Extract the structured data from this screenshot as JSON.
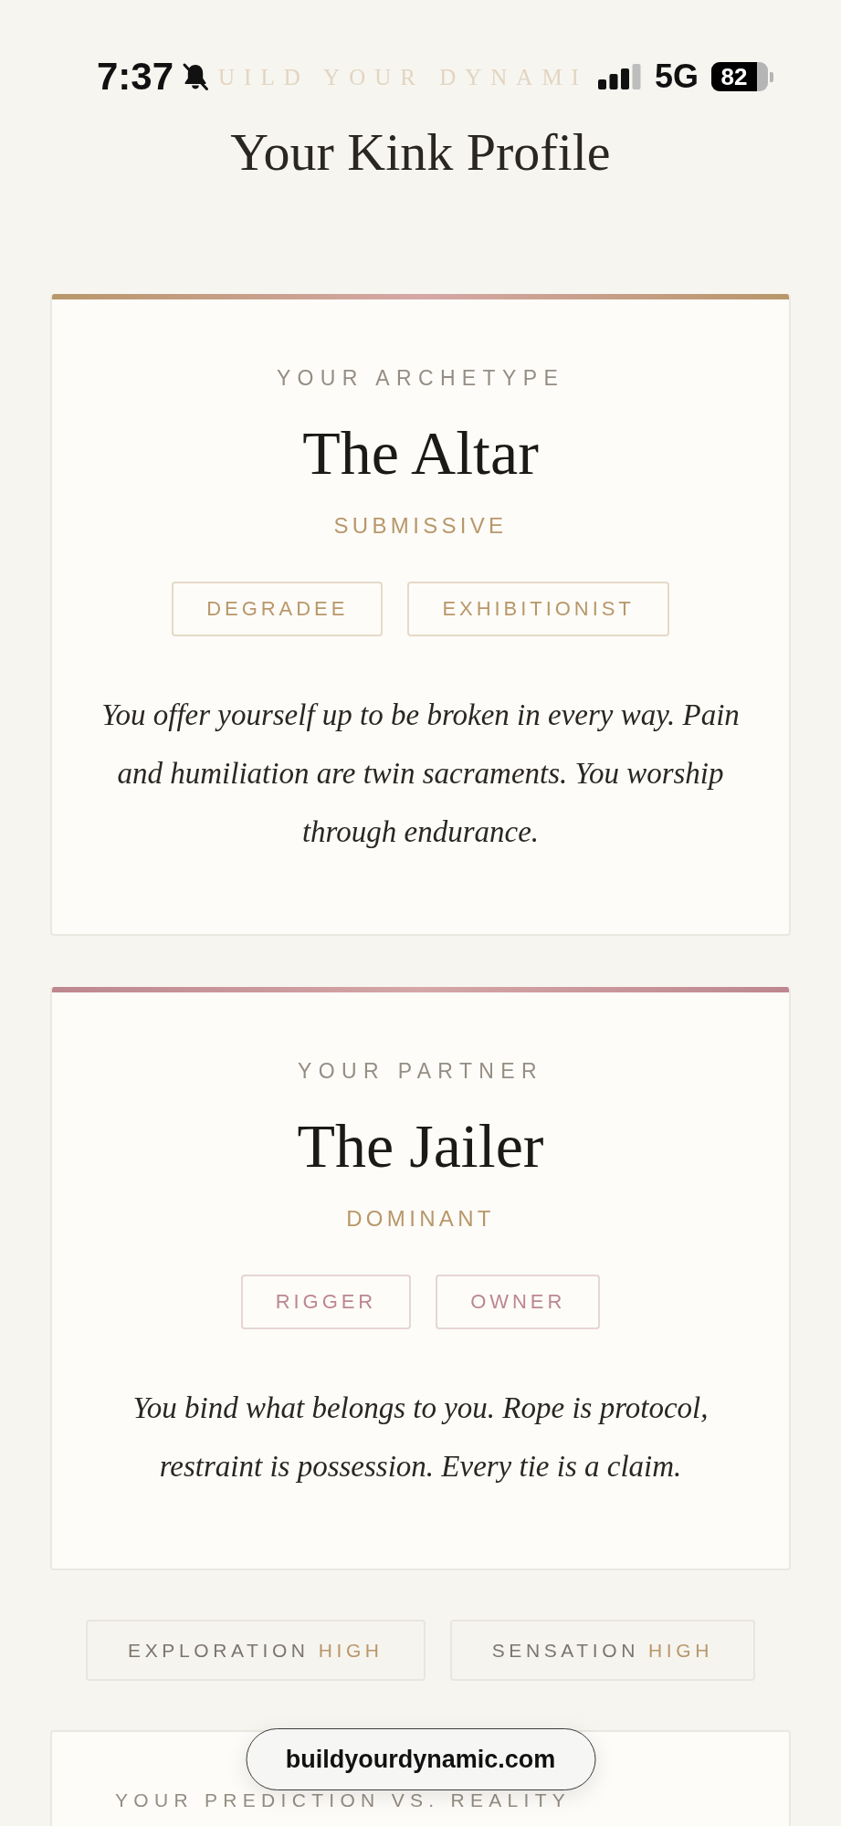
{
  "status_bar": {
    "time": "7:37",
    "network": "5G",
    "battery": "82"
  },
  "header": {
    "site_name": "UILD YOUR DYNAMI",
    "title": "Your Kink Profile"
  },
  "cards": [
    {
      "label": "YOUR ARCHETYPE",
      "name": "The Altar",
      "role": "SUBMISSIVE",
      "color": "#b8976a",
      "tags": [
        "DEGRADEE",
        "EXHIBITIONIST"
      ],
      "description": "You offer yourself up to be broken in every way. Pain and humiliation are twin sacraments. You worship through endurance."
    },
    {
      "label": "YOUR PARTNER",
      "name": "The Jailer",
      "role": "DOMINANT",
      "color": "#bd8790",
      "tags": [
        "RIGGER",
        "OWNER"
      ],
      "description": "You bind what belongs to you. Rope is protocol, restraint is possession. Every tie is a claim."
    }
  ],
  "stats": [
    {
      "label": "EXPLORATION",
      "value": "HIGH"
    },
    {
      "label": "SENSATION",
      "value": "HIGH"
    }
  ],
  "prediction": {
    "label": "YOUR PREDICTION VS. REALITY"
  },
  "url_bar": {
    "address": "buildyourdynamic.com"
  }
}
